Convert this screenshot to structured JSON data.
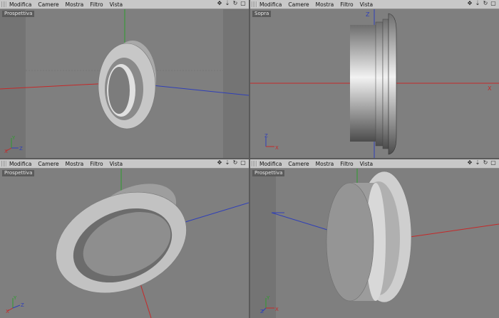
{
  "viewports": [
    {
      "id": "top-left",
      "label": "Prospettiva",
      "menu": [
        "Modifica",
        "Camere",
        "Mostra",
        "Filtro",
        "Vista"
      ]
    },
    {
      "id": "top-right",
      "label": "Sopra",
      "menu": [
        "Modifica",
        "Camere",
        "Mostra",
        "Filtro",
        "Vista"
      ]
    },
    {
      "id": "bottom-left",
      "label": "Prospettiva",
      "menu": [
        "Modifica",
        "Camere",
        "Mostra",
        "Filtro",
        "Vista"
      ]
    },
    {
      "id": "bottom-right",
      "label": "Prospettiva",
      "menu": [
        "Modifica",
        "Camere",
        "Mostra",
        "Filtro",
        "Vista"
      ]
    }
  ],
  "axes_colors": {
    "x": "#c62828",
    "y": "#2e9c2e",
    "z": "#2f3fb8"
  },
  "axis_letters": {
    "x": "X",
    "y": "Y",
    "z": "Z"
  },
  "nav_icons": [
    "move-icon",
    "zoom-icon",
    "rotate-icon",
    "maximize-icon"
  ]
}
